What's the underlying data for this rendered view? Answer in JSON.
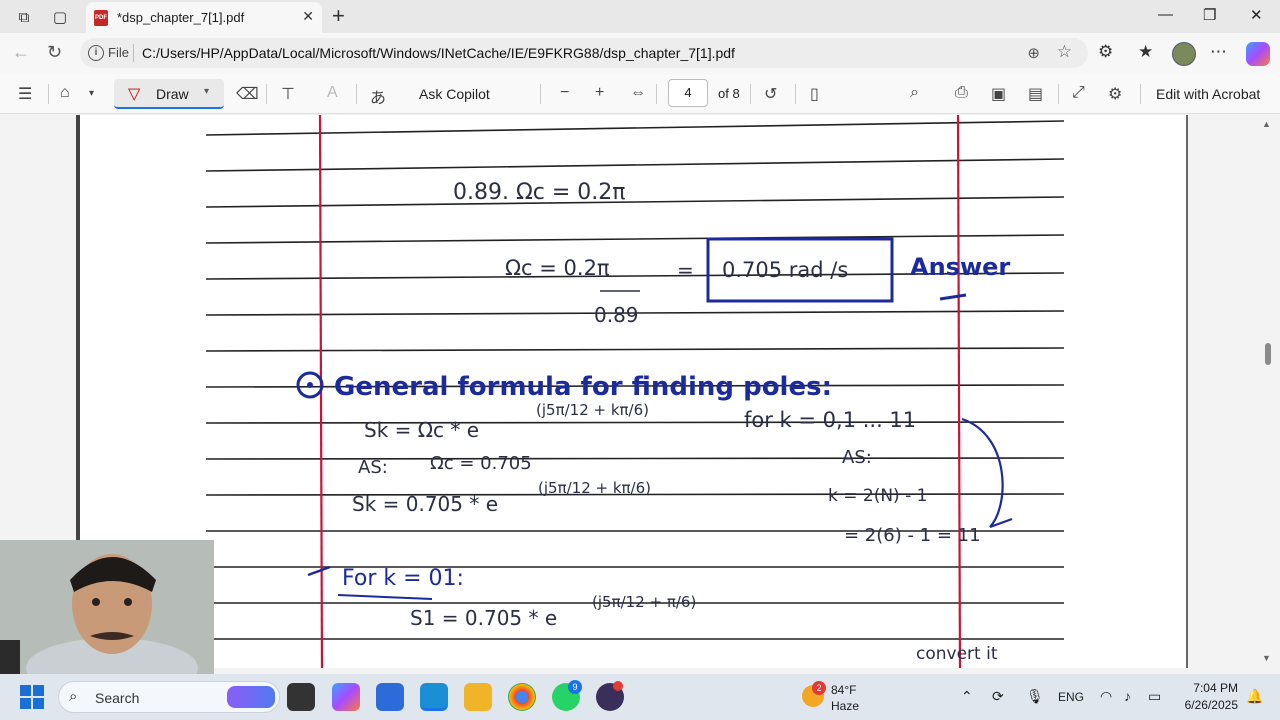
{
  "browser": {
    "tab_title": "*dsp_chapter_7[1].pdf",
    "new_tab": "+",
    "address_scheme": "File",
    "address_url": "C:/Users/HP/AppData/Local/Microsoft/Windows/INetCache/IE/E9FKRG88/dsp_chapter_7[1].pdf"
  },
  "pdf_toolbar": {
    "draw_label": "Draw",
    "ask_copilot": "Ask Copilot",
    "page_current": "4",
    "page_total": "of 8",
    "edit_acrobat": "Edit with Acrobat"
  },
  "document": {
    "line1": "0.89. Ωc = 0.2π",
    "line2_left": "Ωc = 0.2π",
    "line2_eq": "=",
    "line2_boxed": "0.705 rad /s",
    "line2_answer": "Answer",
    "line3": "0.89",
    "heading": "General formula for finding poles:",
    "formula_sk": "Sk = Ωc * e",
    "formula_exp": "(j5π/12 + kπ/6)",
    "formula_for": "for k = 0,1 ... 11",
    "as_left": "AS:",
    "omega_value": "Ωc = 0.705",
    "as_right": "AS:",
    "sk_sub": "Sk = 0.705 * e",
    "sk_sub_exp": "(j5π/12 + kπ/6)",
    "k_def": "k = 2(N) - 1",
    "k_calc": "= 2(6) - 1 = 11",
    "for_k": "For k = 01:",
    "s1": "S1 = 0.705 * e",
    "s1_exp": "(j5π/12 + π/6)",
    "convert": "convert it"
  },
  "taskbar": {
    "search_label": "Search",
    "whatsapp_badge": "9",
    "weather_badge": "2",
    "temperature": "84°F",
    "condition": "Haze",
    "language": "ENG",
    "time": "7:04 PM",
    "date": "6/26/2025"
  },
  "colors": {
    "ink_blue": "#1b2a9c",
    "ink_dark": "#2a2f45",
    "margin_red": "#c8143c",
    "accent": "#1a73e8"
  }
}
